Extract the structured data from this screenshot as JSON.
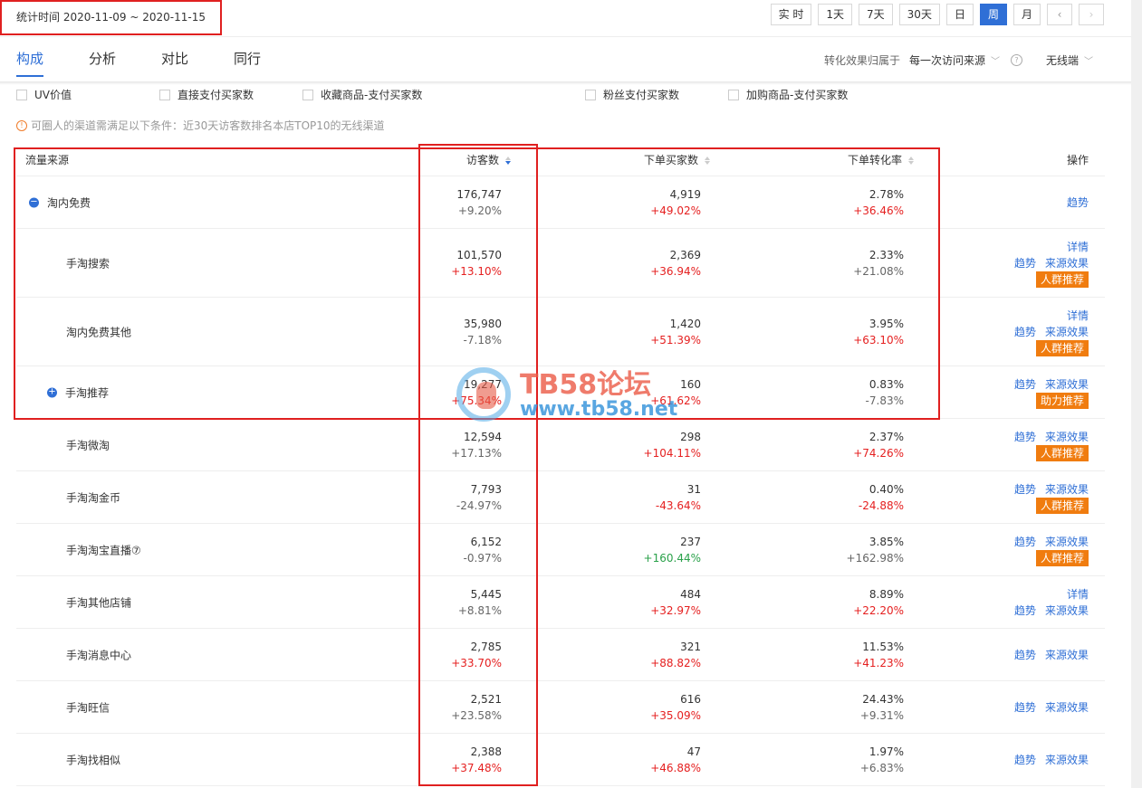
{
  "date_range": "统计时间 2020-11-09 ~ 2020-11-15",
  "periods": [
    "实 时",
    "1天",
    "7天",
    "30天",
    "日",
    "周",
    "月"
  ],
  "active_period": "周",
  "tabs": [
    "构成",
    "分析",
    "对比",
    "同行"
  ],
  "active_tab": "构成",
  "attribution": {
    "label": "转化效果归属于",
    "value": "每一次访问来源",
    "device": "无线端"
  },
  "metrics": [
    "UV价值",
    "直接支付买家数",
    "收藏商品-支付买家数",
    "粉丝支付买家数",
    "加购商品-支付买家数"
  ],
  "notice": "可圈人的渠道需满足以下条件：近30天访客数排名本店TOP10的无线渠道",
  "table": {
    "headers": {
      "source": "流量来源",
      "visitors": "访客数",
      "buyers": "下单买家数",
      "conversion": "下单转化率",
      "actions": "操作"
    },
    "rows": [
      {
        "name": "淘内免费",
        "toggle": "−",
        "visitors": "176,747",
        "visitors_delta": "+9.20%",
        "buyers": "4,919",
        "buyers_delta": "+49.02%",
        "rate": "2.78%",
        "rate_delta": "+36.46%",
        "action_lines": [
          [
            "趋势"
          ]
        ]
      },
      {
        "name": "手淘搜索",
        "visitors": "101,570",
        "visitors_delta": "+13.10%",
        "buyers": "2,369",
        "buyers_delta": "+36.94%",
        "rate": "2.33%",
        "rate_delta": "+21.08%",
        "action_lines": [
          [
            "详情"
          ],
          [
            "趋势",
            "来源效果"
          ]
        ],
        "badge": "人群推荐"
      },
      {
        "name": "淘内免费其他",
        "visitors": "35,980",
        "visitors_delta": "-7.18%",
        "buyers": "1,420",
        "buyers_delta": "+51.39%",
        "rate": "3.95%",
        "rate_delta": "+63.10%",
        "action_lines": [
          [
            "详情"
          ],
          [
            "趋势",
            "来源效果"
          ]
        ],
        "badge": "人群推荐"
      },
      {
        "name": "手淘推荐",
        "toggle": "+",
        "visitors": "19,277",
        "visitors_delta": "+75.34%",
        "buyers": "160",
        "buyers_delta": "+61.62%",
        "rate": "0.83%",
        "rate_delta": "-7.83%",
        "action_lines": [
          [
            "趋势",
            "来源效果"
          ]
        ],
        "badge": "助力推荐"
      },
      {
        "name": "手淘微淘",
        "visitors": "12,594",
        "visitors_delta": "+17.13%",
        "buyers": "298",
        "buyers_delta": "+104.11%",
        "rate": "2.37%",
        "rate_delta": "+74.26%",
        "action_lines": [
          [
            "趋势",
            "来源效果"
          ]
        ],
        "badge": "人群推荐"
      },
      {
        "name": "手淘淘金币",
        "visitors": "7,793",
        "visitors_delta": "-24.97%",
        "buyers": "31",
        "buyers_delta": "-43.64%",
        "rate": "0.40%",
        "rate_delta": "-24.88%",
        "action_lines": [
          [
            "趋势",
            "来源效果"
          ]
        ],
        "badge": "人群推荐"
      },
      {
        "name": "手淘淘宝直播⑦",
        "visitors": "6,152",
        "visitors_delta": "-0.97%",
        "buyers": "237",
        "buyers_delta": "+160.44%",
        "rate": "3.85%",
        "rate_delta": "+162.98%",
        "action_lines": [
          [
            "趋势",
            "来源效果"
          ]
        ],
        "badge": "人群推荐"
      },
      {
        "name": "手淘其他店铺",
        "visitors": "5,445",
        "visitors_delta": "+8.81%",
        "buyers": "484",
        "buyers_delta": "+32.97%",
        "rate": "8.89%",
        "rate_delta": "+22.20%",
        "action_lines": [
          [
            "详情"
          ],
          [
            "趋势",
            "来源效果"
          ]
        ]
      },
      {
        "name": "手淘消息中心",
        "visitors": "2,785",
        "visitors_delta": "+33.70%",
        "buyers": "321",
        "buyers_delta": "+88.82%",
        "rate": "11.53%",
        "rate_delta": "+41.23%",
        "action_lines": [
          [
            "趋势",
            "来源效果"
          ]
        ]
      },
      {
        "name": "手淘旺信",
        "visitors": "2,521",
        "visitors_delta": "+23.58%",
        "buyers": "616",
        "buyers_delta": "+35.09%",
        "rate": "24.43%",
        "rate_delta": "+9.31%",
        "action_lines": [
          [
            "趋势",
            "来源效果"
          ]
        ]
      },
      {
        "name": "手淘找相似",
        "visitors": "2,388",
        "visitors_delta": "+37.48%",
        "buyers": "47",
        "buyers_delta": "+46.88%",
        "rate": "1.97%",
        "rate_delta": "+6.83%",
        "action_lines": [
          [
            "趋势",
            "来源效果"
          ]
        ]
      }
    ]
  },
  "delta_colors": {
    "visitors": [
      "gray",
      "red",
      "gray",
      "red",
      "gray",
      "gray",
      "gray",
      "gray",
      "red",
      "gray",
      "red"
    ],
    "buyers": [
      "red",
      "red",
      "red",
      "red",
      "red",
      "red",
      "green",
      "red",
      "red",
      "red",
      "red"
    ],
    "rate": [
      "red",
      "gray",
      "red",
      "gray",
      "red",
      "red",
      "gray",
      "red",
      "red",
      "gray",
      "gray"
    ]
  },
  "watermark": {
    "title": "TB58论坛",
    "url": "www.tb58.net"
  }
}
